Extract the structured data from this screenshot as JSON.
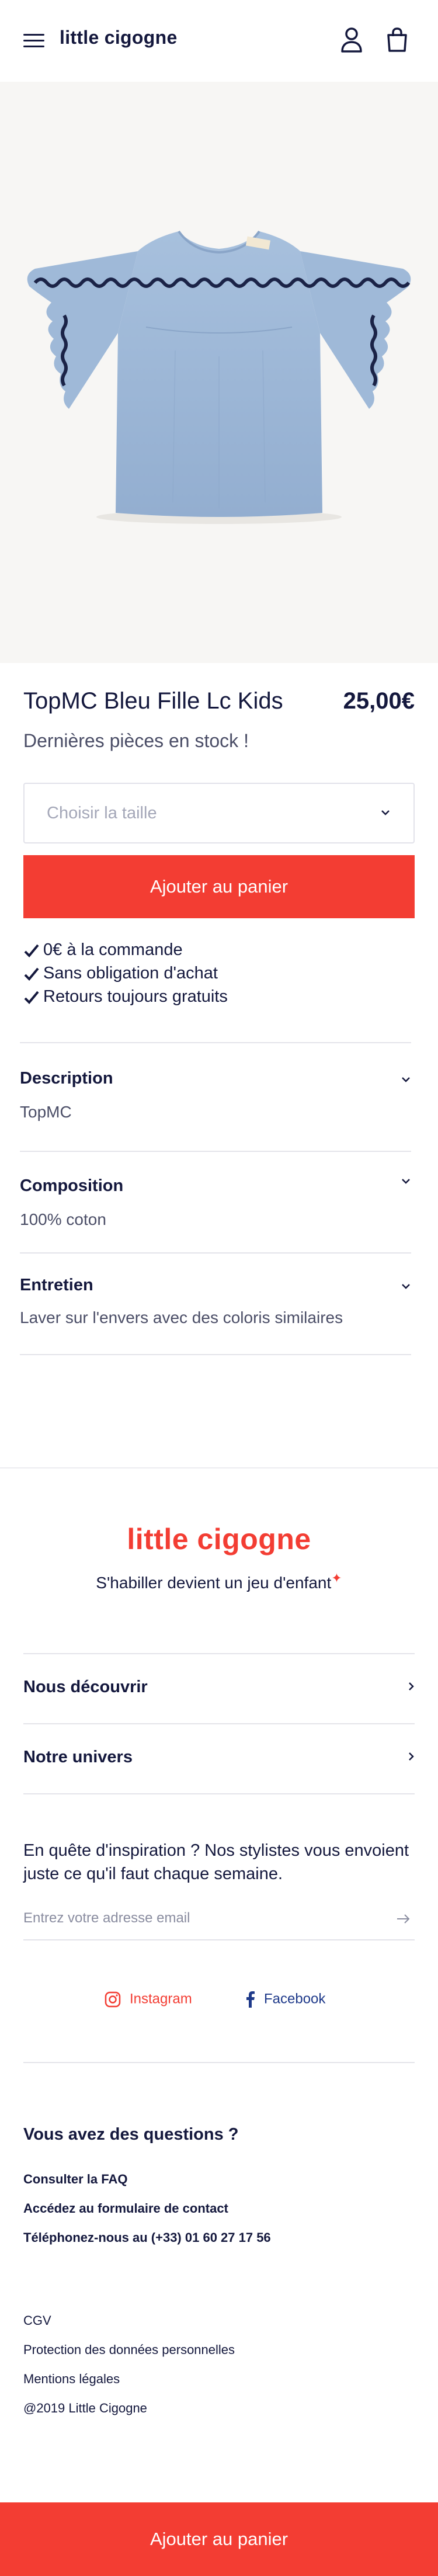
{
  "brand": "little cigogne",
  "product": {
    "title": "TopMC Bleu Fille Lc Kids",
    "price": "25,00€",
    "stock": "Dernières pièces en stock !",
    "size_placeholder": "Choisir la taille",
    "add_to_cart": "Ajouter au panier"
  },
  "benefits": [
    "0€ à la commande",
    "Sans obligation d'achat",
    "Retours toujours gratuits"
  ],
  "accordion": [
    {
      "title": "Description",
      "body": "TopMC"
    },
    {
      "title": "Composition",
      "body": "100% coton"
    },
    {
      "title": "Entretien",
      "body": "Laver sur l'envers avec des coloris similaires"
    }
  ],
  "footer": {
    "logo": "little cigogne",
    "tagline": "S'habiller devient un jeu d'enfant",
    "nav": [
      "Nous découvrir",
      "Notre univers"
    ],
    "newsletter_text": "En quête d'inspiration ? Nos stylistes vous envoient juste ce qu'il faut chaque semaine.",
    "email_placeholder": "Entrez votre adresse email",
    "social": {
      "instagram": "Instagram",
      "facebook": "Facebook"
    },
    "questions_title": "Vous avez des questions ?",
    "help_links": [
      "Consulter la FAQ",
      "Accédez au formulaire de contact",
      "Téléphonez-nous au (+33) 01 60 27 17 56"
    ],
    "legal_links": [
      "CGV",
      "Protection des données personnelles",
      "Mentions légales"
    ],
    "copyright": "@2019 Little Cigogne"
  },
  "sticky_cta": "Ajouter au panier",
  "icons": {
    "menu": "hamburger-menu-icon",
    "account": "user-icon",
    "cart": "shopping-bag-icon",
    "check": "check-icon",
    "chevron_down": "chevron-down-icon",
    "chevron_right": "chevron-right-icon",
    "arrow_right": "arrow-right-icon",
    "instagram": "instagram-icon",
    "facebook": "facebook-icon"
  },
  "colors": {
    "accent": "#f33d33",
    "navy": "#14183d",
    "facebook": "#1f3a8a",
    "product_bg": "#f7f6f4"
  }
}
